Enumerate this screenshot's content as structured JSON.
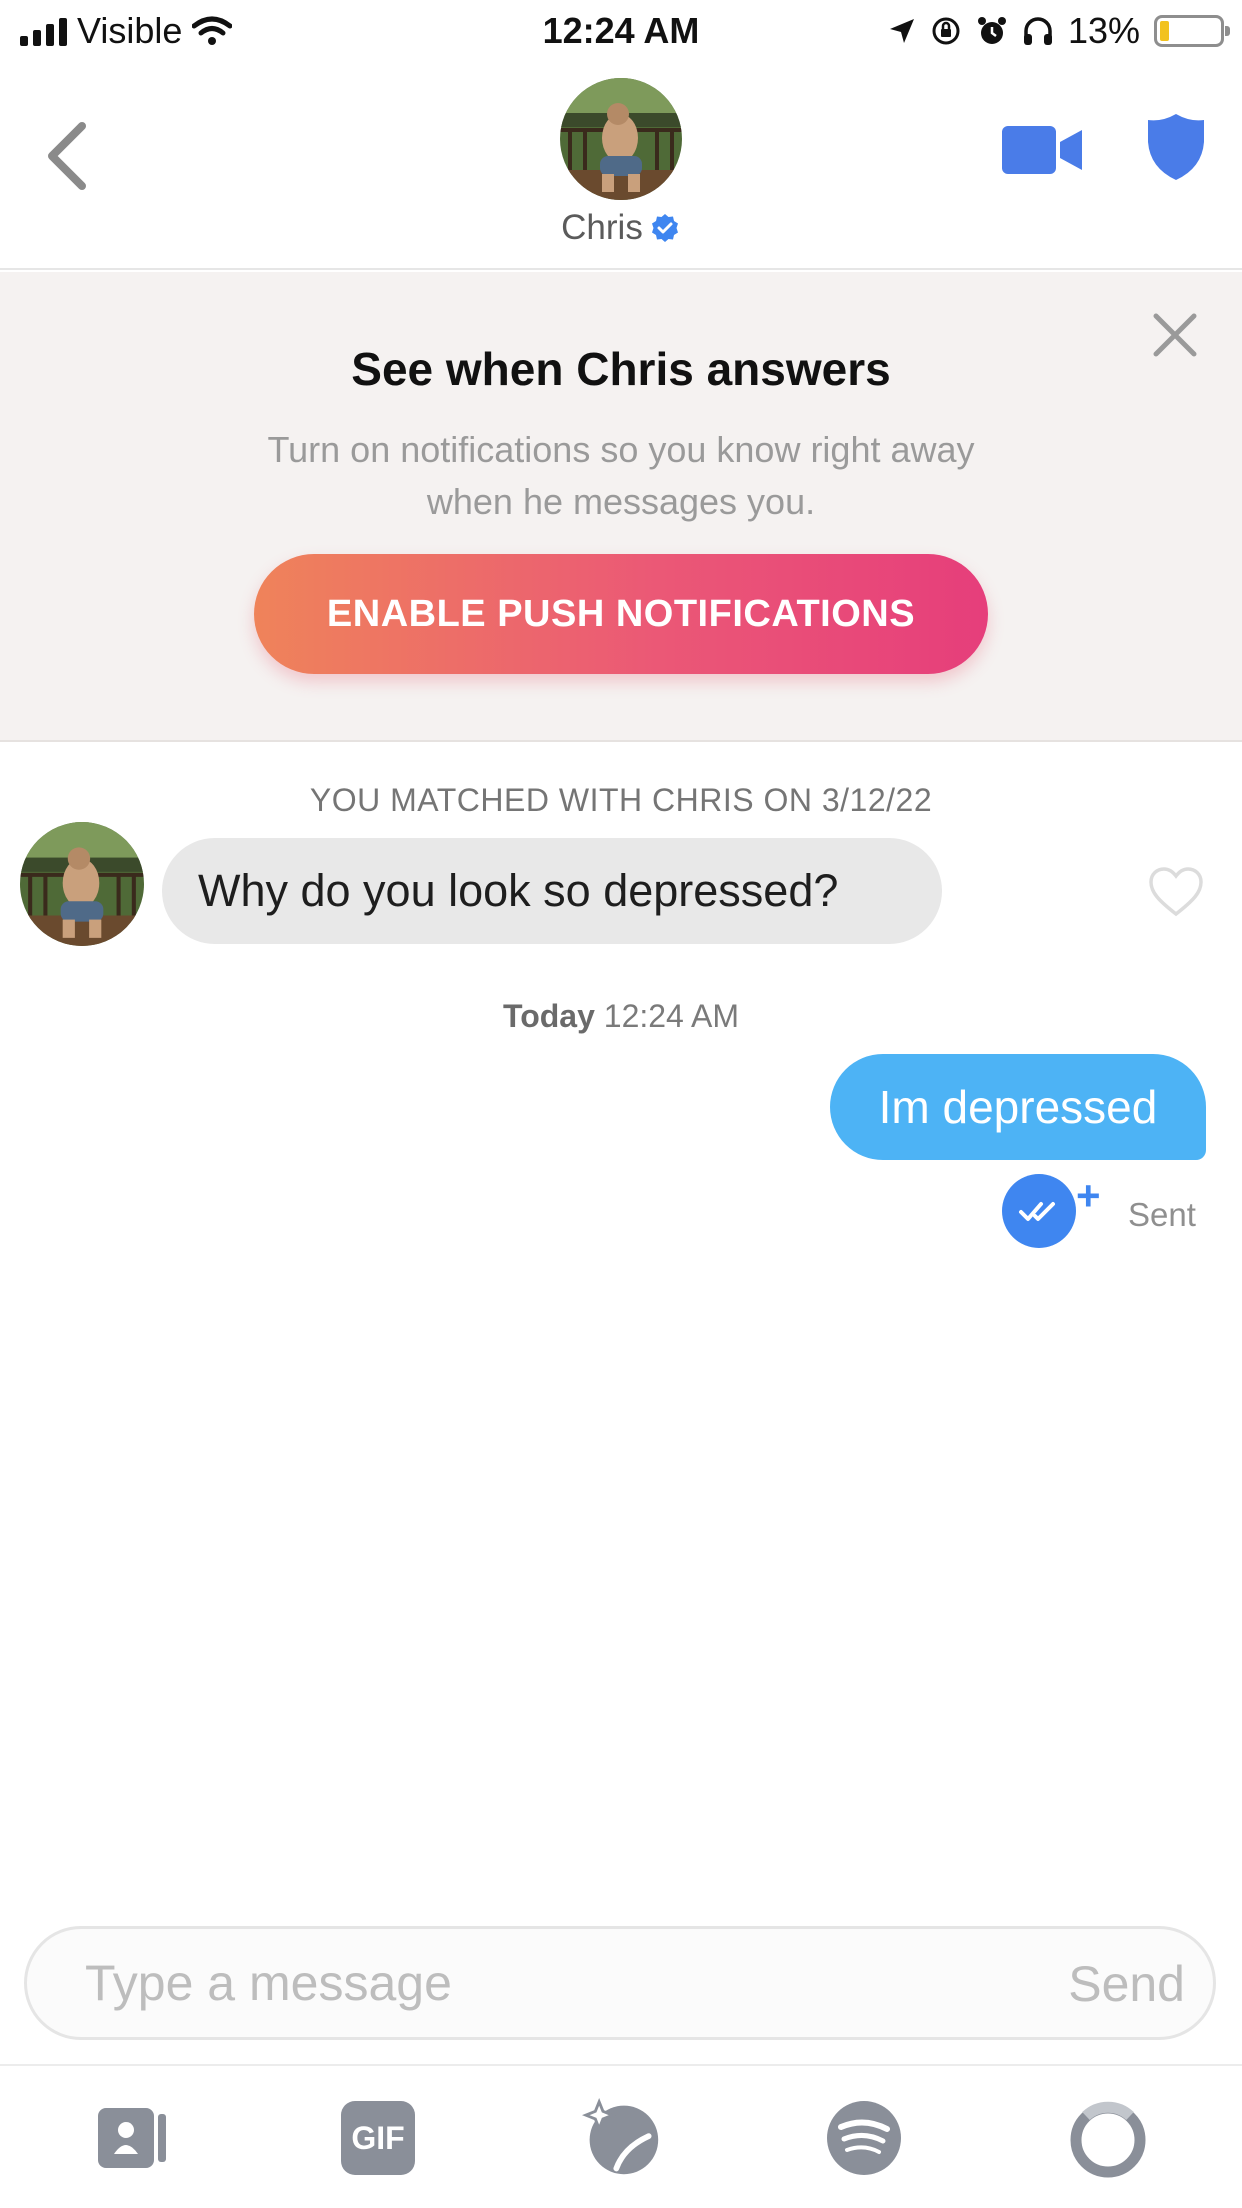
{
  "status_bar": {
    "carrier": "Visible",
    "time": "12:24 AM",
    "battery_percent": "13%",
    "battery_level": 0.13
  },
  "header": {
    "contact_name": "Chris",
    "verified": true,
    "accent_color": "#3f86f0"
  },
  "banner": {
    "title": "See when Chris answers",
    "text": "Turn on notifications so you know right away when he messages you.",
    "button_label": "ENABLE PUSH NOTIFICATIONS"
  },
  "chat": {
    "match_text": "YOU MATCHED WITH CHRIS ON 3/12/22",
    "incoming_message": "Why do you look so depressed?",
    "timestamp_day": "Today",
    "timestamp_time": "12:24 AM",
    "outgoing_message": "Im depressed",
    "outgoing_color": "#4db3f5",
    "read_plus": "+",
    "status": "Sent"
  },
  "composer": {
    "placeholder": "Type a message",
    "send_label": "Send"
  },
  "toolbar": {
    "gif_label": "GIF",
    "icons": [
      "contact-card-icon",
      "gif-icon",
      "sparkle-sticker-icon",
      "spotify-icon",
      "ring-icon"
    ]
  }
}
